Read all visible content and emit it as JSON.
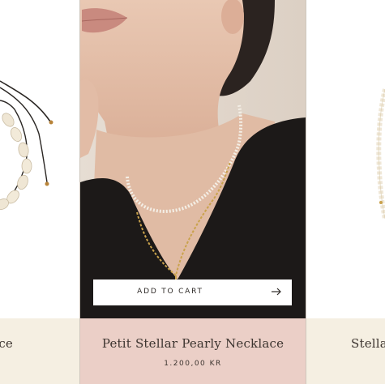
{
  "products": [
    {
      "name": "Cowrie Shell Necklace",
      "price": "",
      "visible_name_fragment": "ace"
    },
    {
      "name": "Petit Stellar Pearly Necklace",
      "price": "1.200,00 KR",
      "add_to_cart_label": "ADD TO CART"
    },
    {
      "name": "Stellar",
      "price": ""
    }
  ],
  "icons": {
    "cart_arrow": "arrow-right-icon"
  },
  "colors": {
    "info_bg": "#f5efe2",
    "active_info_bg": "#ebcfc7",
    "text": "#3d3530",
    "button_bg": "#ffffff"
  }
}
